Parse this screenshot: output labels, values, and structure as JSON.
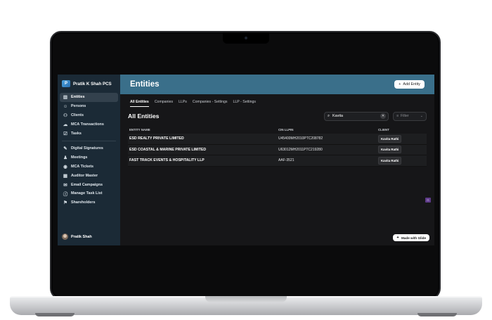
{
  "brand": {
    "logo": "P",
    "name": "Pratik K Shah PCS"
  },
  "nav": [
    {
      "label": "Entities",
      "icon": "building-icon"
    },
    {
      "label": "Persons",
      "icon": "person-icon"
    },
    {
      "label": "Clients",
      "icon": "people-icon"
    },
    {
      "label": "MCA Transactions",
      "icon": "cloud-icon"
    },
    {
      "label": "Tasks",
      "icon": "task-icon"
    },
    {
      "label": "Digital Signatures",
      "icon": "signature-icon"
    },
    {
      "label": "Meetings",
      "icon": "meeting-icon"
    },
    {
      "label": "MCA Tickets",
      "icon": "ticket-icon"
    },
    {
      "label": "Auditor Master",
      "icon": "grid-icon"
    },
    {
      "label": "Email Campaigns",
      "icon": "megaphone-icon"
    },
    {
      "label": "Manage Task List",
      "icon": "info-icon"
    },
    {
      "label": "Shareholders",
      "icon": "share-icon"
    }
  ],
  "user": {
    "name": "Pratik Shah"
  },
  "header": {
    "title": "Entities",
    "add_button": "Add Entity"
  },
  "tabs": [
    "All Entities",
    "Companies",
    "LLPs",
    "Companies - Settings",
    "LLP - Settings"
  ],
  "list": {
    "title": "All Entities",
    "search_value": "Kavita",
    "filter_placeholder": "Filter"
  },
  "table": {
    "columns": [
      "ENTITY NAME",
      "CIN LLPIN",
      "CLIENT"
    ],
    "rows": [
      {
        "name": "ESD REALTY PRIVATE LIMITED",
        "cin": "U45400MH2010PTC208782",
        "client": "Kavita Rathi"
      },
      {
        "name": "ESD COASTAL & MARINE PRIVATE LIMITED",
        "cin": "U63012MH2011PTC219280",
        "client": "Kavita Rathi"
      },
      {
        "name": "FAST TRACK EVENTS & HOSPITALITY LLP",
        "cin": "AAF-3521",
        "client": "Kavita Rathi"
      }
    ]
  },
  "footer": {
    "glide_badge": "Made with Glide"
  },
  "widget_label": "G"
}
